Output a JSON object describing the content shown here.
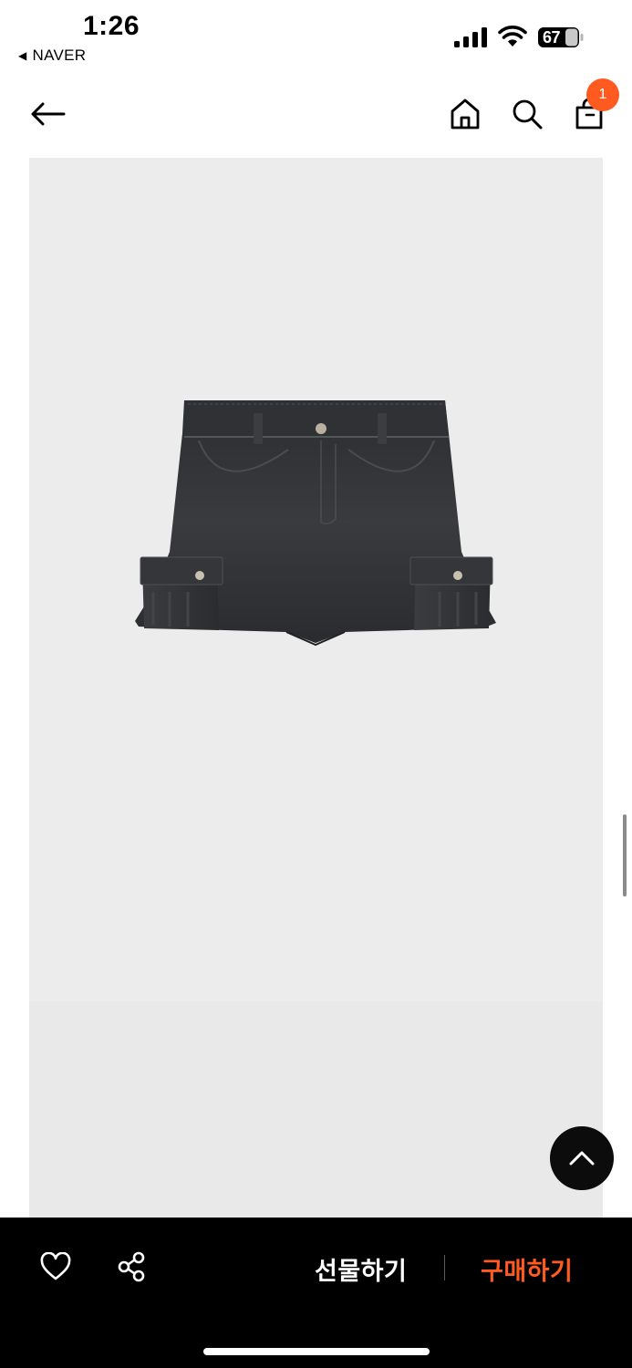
{
  "status_bar": {
    "time": "1:26",
    "back_app": "NAVER",
    "battery": "67"
  },
  "header": {
    "back_icon": "arrow-left-icon",
    "home_icon": "home-icon",
    "search_icon": "search-icon",
    "cart_icon": "shopping-bag-icon",
    "cart_count": "1"
  },
  "product": {
    "image_icon": "denim-mini-skirt-photo"
  },
  "floating": {
    "top_icon": "chevron-up-icon"
  },
  "bottom_bar": {
    "like_icon": "heart-icon",
    "share_icon": "share-icon",
    "gift_label": "선물하기",
    "buy_label": "구매하기"
  },
  "colors": {
    "accent": "#ff5a1f",
    "bar": "#000000",
    "image_bg": "#ececec"
  }
}
